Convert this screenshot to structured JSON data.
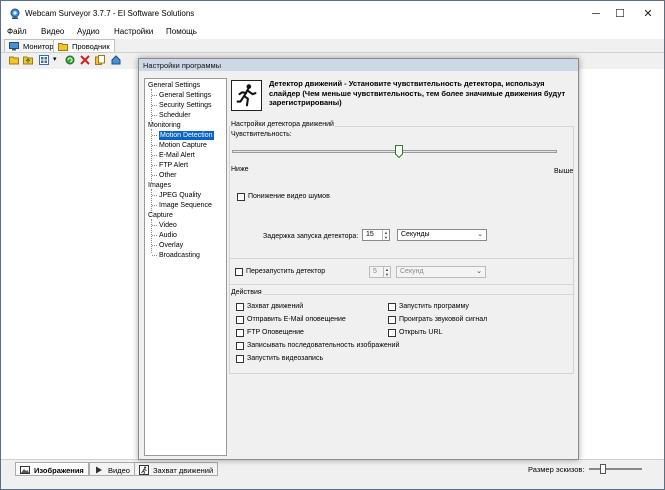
{
  "window": {
    "title": "Webcam Surveyor 3.7.7 - EI Software Solutions",
    "minimize": "─",
    "maximize": "☐",
    "close": "✕"
  },
  "menu": [
    "Файл",
    "Видео",
    "Аудио",
    "Настройки",
    "Помощь"
  ],
  "top_tabs": [
    {
      "label": "Монитор",
      "icon": "monitor-icon"
    },
    {
      "label": "Проводник",
      "icon": "folder-icon"
    }
  ],
  "toolbar_icons": [
    "folder-open-icon",
    "folder-up-icon",
    "view-icon",
    "dropdown-arrow-icon",
    "refresh-icon",
    "delete-icon",
    "copy-icon",
    "home-icon"
  ],
  "dialog": {
    "title": "Настройки программы",
    "tree": [
      {
        "label": "General Settings",
        "level": 0
      },
      {
        "label": "General Settings",
        "level": 1
      },
      {
        "label": "Security Settings",
        "level": 1
      },
      {
        "label": "Scheduler",
        "level": 1
      },
      {
        "label": "Monitoring",
        "level": 0
      },
      {
        "label": "Motion Detection",
        "level": 1,
        "selected": true
      },
      {
        "label": "Motion Capture",
        "level": 1
      },
      {
        "label": "E-Mail Alert",
        "level": 1
      },
      {
        "label": "FTP Alert",
        "level": 1
      },
      {
        "label": "Other",
        "level": 1
      },
      {
        "label": "Images",
        "level": 0
      },
      {
        "label": "JPEG Quality",
        "level": 1
      },
      {
        "label": "Image Sequence",
        "level": 1
      },
      {
        "label": "Capture",
        "level": 0
      },
      {
        "label": "Video",
        "level": 1
      },
      {
        "label": "Audio",
        "level": 1
      },
      {
        "label": "Overlay",
        "level": 1
      },
      {
        "label": "Broadcasting",
        "level": 1
      }
    ],
    "header_line1": "Детектор движений - Установите чувствительность детектора, используя",
    "header_line2": "слайдер (Чем меньше чувствительность, тем более значимые движения будут",
    "header_line3": "зарегистрированы)",
    "detector_group": {
      "title": "Настройки детектора движений",
      "sensitivity_label": "Чувствительность:",
      "low_label": "Ниже",
      "high_label": "Выше",
      "noise_label": "Понижение видео шумов",
      "noise_checked": false,
      "delay_label": "Задержка запуска детектора:",
      "delay_value": "15",
      "delay_unit": "Секунды"
    },
    "restart_group": {
      "label": "Перезапустить детектор",
      "checked": false,
      "value": "5",
      "unit": "Секунд"
    },
    "actions_group": {
      "title": "Действия",
      "left": [
        {
          "label": "Захват движений",
          "checked": false
        },
        {
          "label": "Отправить E-Mail оповещение",
          "checked": false
        },
        {
          "label": "FTP Оповещение",
          "checked": false
        },
        {
          "label": "Записывать последовательность изображений",
          "checked": false
        },
        {
          "label": "Запустить видеозапись",
          "checked": false
        }
      ],
      "right": [
        {
          "label": "Запустить программу",
          "checked": false
        },
        {
          "label": "Проиграть звуковой сигнал",
          "checked": false
        },
        {
          "label": "Открыть URL",
          "checked": false
        }
      ]
    }
  },
  "bottom_tabs": [
    {
      "label": "Изображения",
      "icon": "image-icon",
      "active": true
    },
    {
      "label": "Видео",
      "icon": "play-icon",
      "active": false
    },
    {
      "label": "Захват движений",
      "icon": "motion-icon",
      "active": false
    }
  ],
  "thumb_size_label": "Размер эскизов:",
  "colors": {
    "selection": "#0a64c8",
    "dialog_title_bg": "#cdd8e6",
    "window_bg": "#f0f0f0"
  }
}
